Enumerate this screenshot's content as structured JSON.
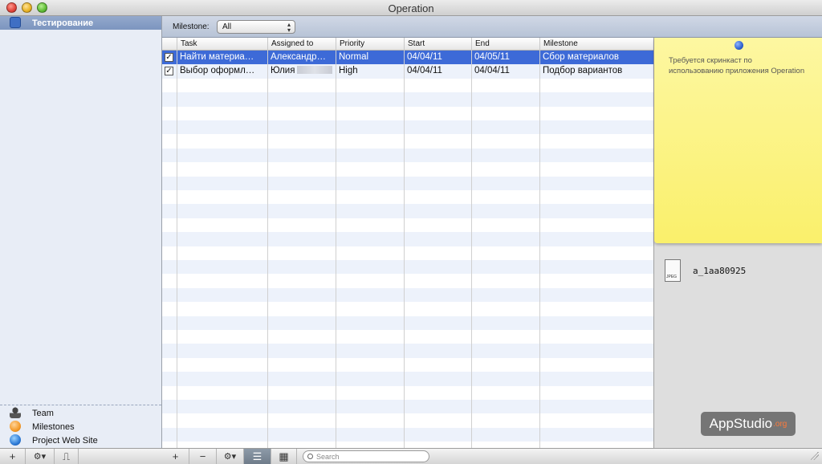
{
  "window": {
    "title": "Operation"
  },
  "sidebar": {
    "project": "Тестирование",
    "items": [
      {
        "label": "Team",
        "icon": "team-icon"
      },
      {
        "label": "Milestones",
        "icon": "milestones-icon"
      },
      {
        "label": "Project Web Site",
        "icon": "globe-icon"
      }
    ]
  },
  "milestone_bar": {
    "label": "Milestone:",
    "selected": "All"
  },
  "table": {
    "columns": [
      "Task",
      "Assigned to",
      "Priority",
      "Start",
      "End",
      "Milestone"
    ],
    "rows": [
      {
        "done": "✓",
        "task": "Найти материа…",
        "assigned": "Александр…",
        "priority": "Normal",
        "start": "04/04/11",
        "end": "04/05/11",
        "milestone": "Сбор материалов"
      },
      {
        "done": "✓",
        "task": "Выбор оформл…",
        "assigned": "Юлия",
        "priority": "High",
        "start": "04/04/11",
        "end": "04/04/11",
        "milestone": "Подбор вариантов"
      }
    ]
  },
  "note": {
    "text": "Требуется скринкаст по использованию приложения Operation"
  },
  "attachment": {
    "name": "a_1aa80925",
    "type_label": "JPEG"
  },
  "bottombar": {
    "left_buttons": [
      "+",
      "⚙▾",
      "⎍"
    ],
    "table_buttons": [
      "+",
      "−",
      "⚙▾"
    ],
    "search_placeholder": "Search"
  },
  "watermark": {
    "text": "AppStudio",
    "suffix": ".org"
  },
  "colors": {
    "selection": "#3d6ad7",
    "note": "#faf06b",
    "sidebar": "#e8edf6"
  }
}
